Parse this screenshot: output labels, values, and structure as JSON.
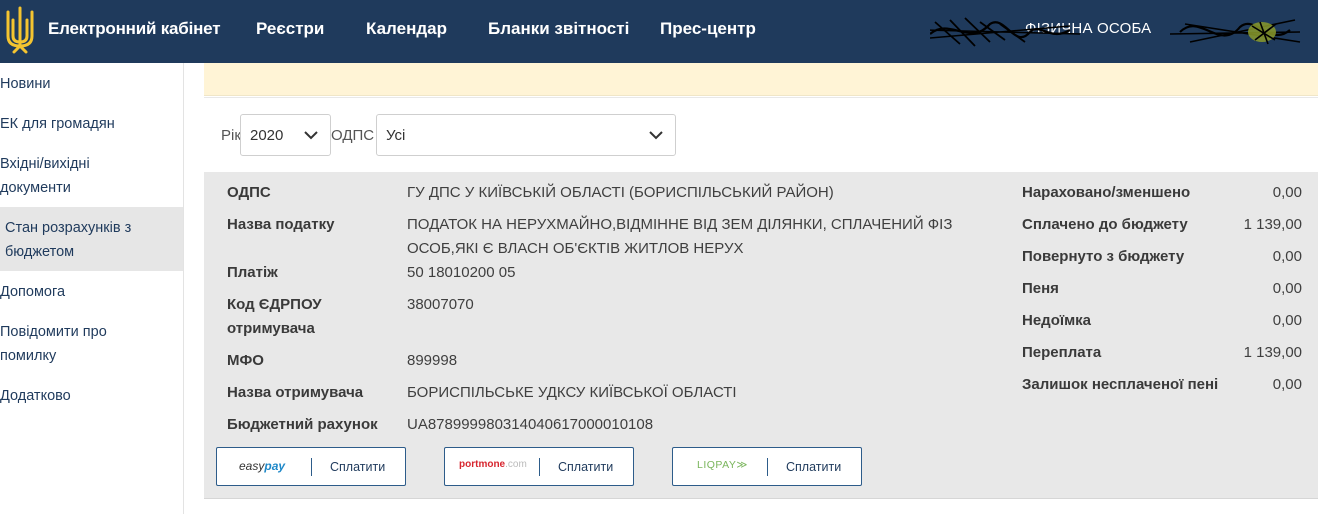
{
  "header": {
    "brand": "Електронний кабінет",
    "nav": [
      "Реєстри",
      "Календар",
      "Бланки звітності",
      "Прес-центр"
    ],
    "user_type": "ФІЗИЧНА ОСОБА"
  },
  "sidebar": {
    "items": [
      {
        "label": "Новини"
      },
      {
        "label": "ЕК для громадян"
      },
      {
        "label_l1": "Вхідні/вихідні",
        "label_l2": "документи"
      },
      {
        "label_l1": "Стан розрахунків з",
        "label_l2": "бюджетом"
      },
      {
        "label": "Допомога"
      },
      {
        "label_l1": "Повідомити про",
        "label_l2": "помилку"
      },
      {
        "label": "Додатково"
      }
    ]
  },
  "filters": {
    "year_label": "Рік",
    "year_value": "2020",
    "odps_label": "ОДПС",
    "odps_value": "Усі"
  },
  "details": {
    "odps_key": "ОДПС",
    "odps_val": "ГУ ДПС У КИЇВСЬКІЙ ОБЛАСТІ (БОРИСПІЛЬСЬКИЙ РАЙОН)",
    "tax_key": "Назва податку",
    "tax_val_l1": "ПОДАТОК НА НЕРУХМАЙНО,ВІДМІННЕ ВІД ЗЕМ ДІЛЯНКИ, СПЛАЧЕНИЙ ФІЗ",
    "tax_val_l2": "ОСОБ,ЯКІ Є ВЛАСН ОБ'ЄКТІВ ЖИТЛОВ НЕРУХ",
    "payment_key": "Платіж",
    "payment_val": "50 18010200 05",
    "edrpou_key_l1": "Код ЄДРПОУ",
    "edrpou_key_l2": "отримувача",
    "edrpou_val": "38007070",
    "mfo_key": "МФО",
    "mfo_val": "899998",
    "recipient_key": "Назва отримувача",
    "recipient_val": "БОРИСПІЛЬСЬКЕ УДКСУ КИЇВСЬКОЇ ОБЛАСТІ",
    "account_key": "Бюджетний рахунок",
    "account_val": "UA878999980314040617000010108"
  },
  "summary": [
    {
      "label": "Нараховано/зменшено",
      "value": "0,00"
    },
    {
      "label": "Сплачено до бюджету",
      "value": "1 139,00"
    },
    {
      "label": "Повернуто з бюджету",
      "value": "0,00"
    },
    {
      "label": "Пеня",
      "value": "0,00"
    },
    {
      "label": "Недоїмка",
      "value": "0,00"
    },
    {
      "label": "Переплата",
      "value": "1 139,00"
    },
    {
      "label": "Залишок несплаченої пені",
      "value": "0,00"
    }
  ],
  "pay_buttons": [
    {
      "brand_a": "easy",
      "brand_b": "pay",
      "label": "Сплатити"
    },
    {
      "brand_a": "portmone",
      "brand_b": ".com",
      "label": "Сплатити"
    },
    {
      "brand_a": "LIQPAY",
      "brand_b": "≫",
      "label": "Сплатити"
    }
  ],
  "colors": {
    "header_bg": "#1f3a5c",
    "notice_bg": "#fff4d6",
    "panel_bg": "#e8e8e8",
    "accent_gold": "#f4c430"
  }
}
